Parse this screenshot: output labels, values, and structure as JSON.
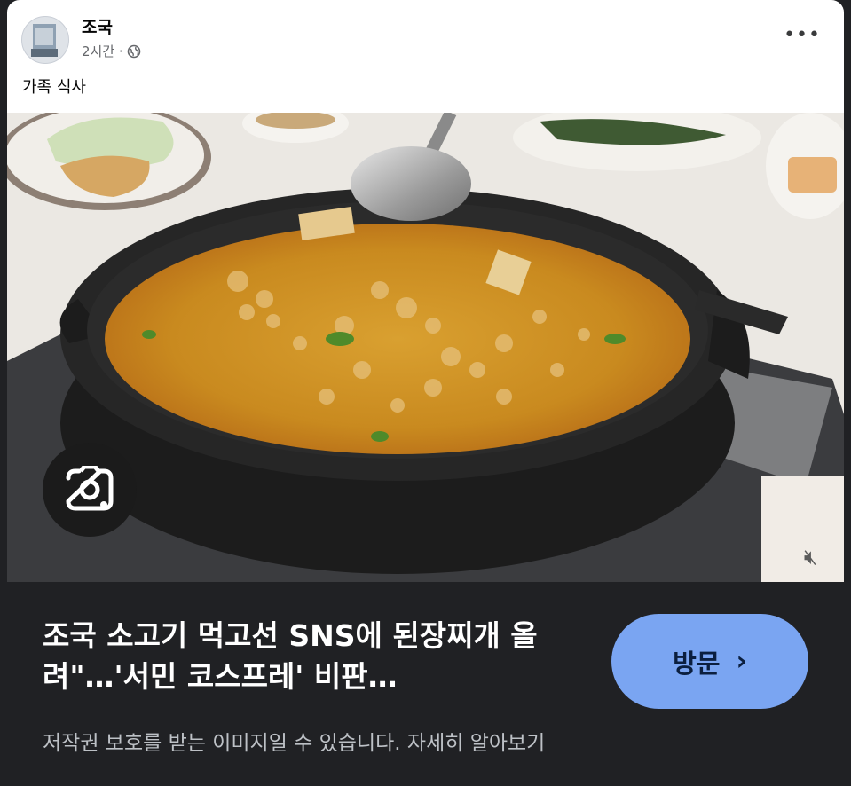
{
  "post": {
    "author": "조국",
    "time": "2시간 ·",
    "caption": "가족 식사",
    "more_icon": "more-horizontal-icon",
    "privacy_icon": "globe-icon"
  },
  "image": {
    "description_icon": "lens-search-icon",
    "sound_icon": "mute-icon"
  },
  "panel": {
    "headline": "조국 소고기 먹고선 SNS에 된장찌개 올려\"…'서민 코스프레' 비판…",
    "visit_label": "방문",
    "visit_icon": "chevron-right-icon",
    "copyright_text": "저작권 보호를 받는 이미지일 수 있습니다.",
    "learn_more": "자세히 알아보기"
  },
  "colors": {
    "panel_bg": "#202124",
    "visit_button": "#7aa5f2",
    "stew": "#c98a1f"
  }
}
